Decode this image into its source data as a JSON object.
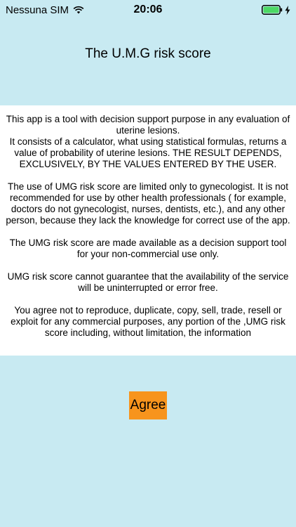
{
  "status_bar": {
    "carrier": "Nessuna SIM",
    "time": "20:06",
    "wifi_icon": "wifi-icon",
    "battery_icon": "battery-icon",
    "charging_icon": "charging-bolt-icon",
    "battery_color": "#4cd964"
  },
  "header": {
    "title": "The U.M.G risk score"
  },
  "disclaimer": {
    "text": "This app is a tool with decision support purpose in any evaluation of uterine lesions.\nIt consists of a calculator, what using statistical formulas, returns a value of probability of uterine lesions. THE RESULT DEPENDS, EXCLUSIVELY, BY THE VALUES ENTERED BY THE USER.\n\nThe use of UMG risk score are limited only to gynecologist.  It is not recommended for use by other health professionals ( for example, doctors do not gynecologist, nurses, dentists, etc.), and any other person, because they lack the knowledge for correct use of the app.\n\nThe UMG risk score are made available as a decision support tool for your non-commercial use only.\n\nUMG risk score cannot guarantee that the availability of the service will be uninterrupted or error free.\n\nYou agree not to reproduce, duplicate, copy, sell, trade, resell or exploit for any commercial purposes, any portion of the ,UMG risk score including, without limitation, the information"
  },
  "agree_button": {
    "label": "Agree",
    "color": "#f7941d"
  },
  "colors": {
    "background": "#c8eaf2",
    "panel": "#ffffff"
  }
}
